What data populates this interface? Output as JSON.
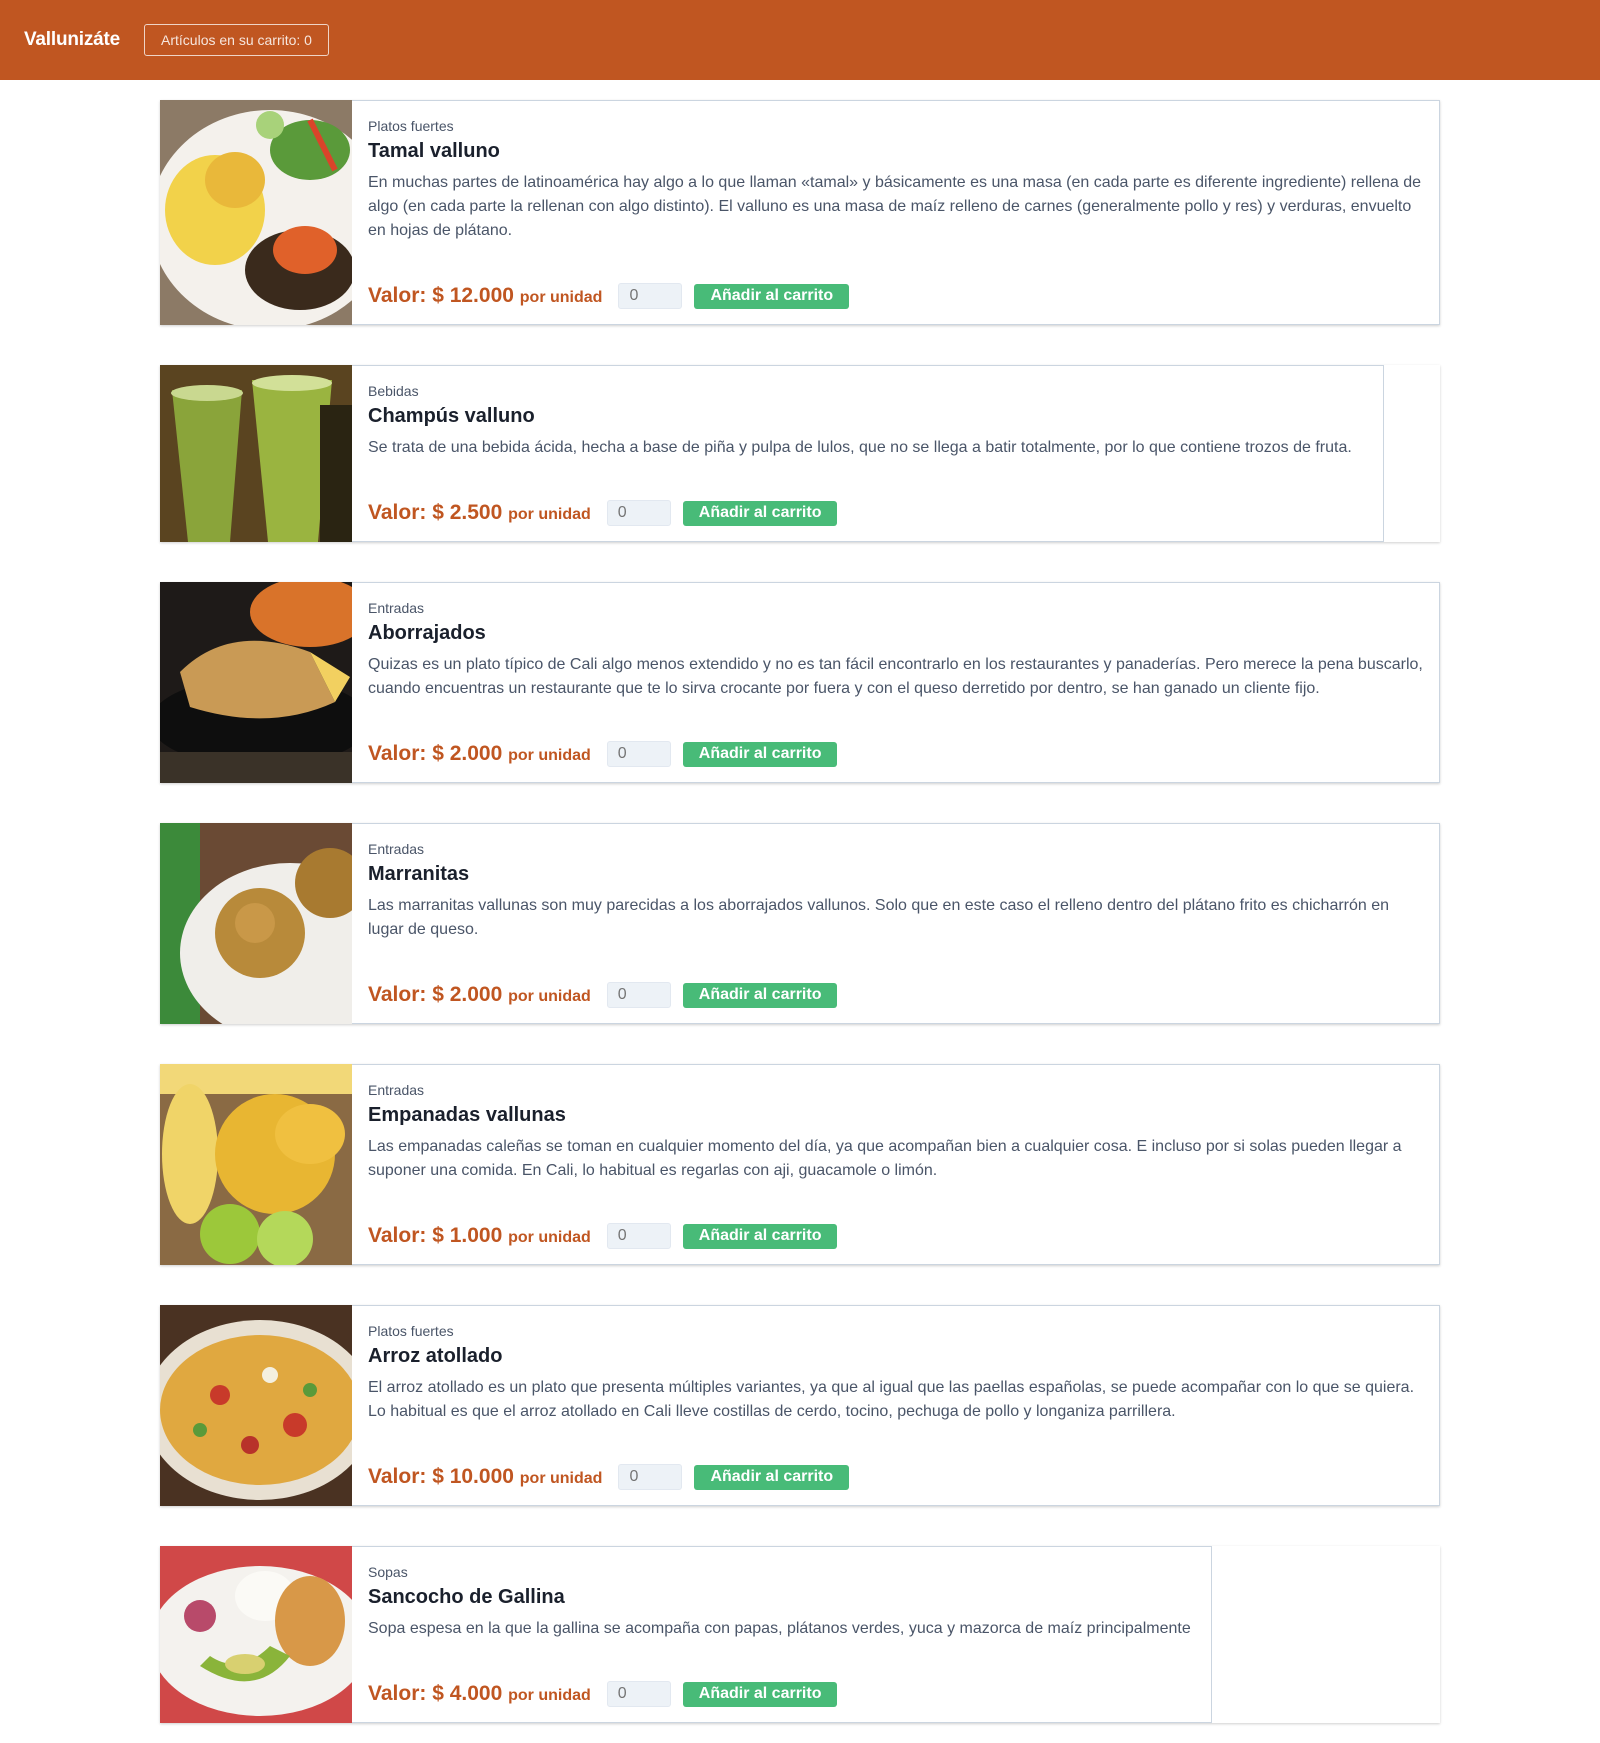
{
  "header": {
    "brand": "Vallunizáte",
    "cart_label": "Artículos en su carrito: 0"
  },
  "products": [
    {
      "category": "Platos fuertes",
      "name": "Tamal valluno",
      "description": "En muchas partes de latinoamérica hay algo a lo que llaman «tamal» y básicamente es una masa (en cada parte es diferente ingrediente) rellena de algo (en cada parte la rellenan con algo distinto). El valluno es una masa de maíz relleno de carnes (generalmente pollo y res) y verduras, envuelto en hojas de plátano.",
      "price": "Valor: $ 12.000",
      "unit": "por unidad",
      "qty_placeholder": "0",
      "button": "Añadir al carrito"
    },
    {
      "category": "Bebidas",
      "name": "Champús valluno",
      "description": "Se trata de una bebida ácida, hecha a base de piña y pulpa de lulos, que no se llega a batir totalmente, por lo que contiene trozos de fruta.",
      "price": "Valor: $ 2.500",
      "unit": "por unidad",
      "qty_placeholder": "0",
      "button": "Añadir al carrito"
    },
    {
      "category": "Entradas",
      "name": "Aborrajados",
      "description": "Quizas es un plato típico de Cali algo menos extendido y no es tan fácil encontrarlo en los restaurantes y panaderías. Pero merece la pena buscarlo, cuando encuentras un restaurante que te lo sirva crocante por fuera y con el queso derretido por dentro, se han ganado un cliente fijo.",
      "price": "Valor: $ 2.000",
      "unit": "por unidad",
      "qty_placeholder": "0",
      "button": "Añadir al carrito"
    },
    {
      "category": "Entradas",
      "name": "Marranitas",
      "description": "Las marranitas vallunas son muy parecidas a los aborrajados vallunos. Solo que en este caso el relleno dentro del plátano frito es chicharrón en lugar de queso.",
      "price": "Valor: $ 2.000",
      "unit": "por unidad",
      "qty_placeholder": "0",
      "button": "Añadir al carrito"
    },
    {
      "category": "Entradas",
      "name": "Empanadas vallunas",
      "description": "Las empanadas caleñas se toman en cualquier momento del día, ya que acompañan bien a cualquier cosa. E incluso por si solas pueden llegar a suponer una comida. En Cali, lo habitual es regarlas con aji, guacamole o limón.",
      "price": "Valor: $ 1.000",
      "unit": "por unidad",
      "qty_placeholder": "0",
      "button": "Añadir al carrito"
    },
    {
      "category": "Platos fuertes",
      "name": "Arroz atollado",
      "description": "El arroz atollado es un plato que presenta múltiples variantes, ya que al igual que las paellas españolas, se puede acompañar con lo que se quiera. Lo habitual es que el arroz atollado en Cali lleve costillas de cerdo, tocino, pechuga de pollo y longaniza parrillera.",
      "price": "Valor: $ 10.000",
      "unit": "por unidad",
      "qty_placeholder": "0",
      "button": "Añadir al carrito"
    },
    {
      "category": "Sopas",
      "name": "Sancocho de Gallina",
      "description": "Sopa espesa en la que la gallina se acompaña con papas, plátanos verdes, yuca y mazorca de maíz principalmente",
      "price": "Valor: $ 4.000",
      "unit": "por unidad",
      "qty_placeholder": "0",
      "button": "Añadir al carrito"
    }
  ],
  "colors": {
    "header_bg": "#c05621",
    "price": "#c05621",
    "button_bg": "#48bb78"
  }
}
